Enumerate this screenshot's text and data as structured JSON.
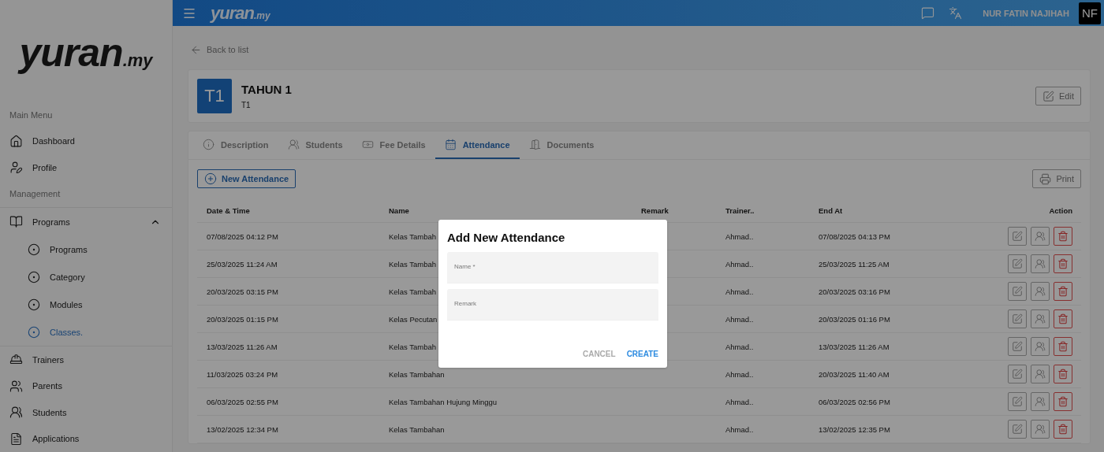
{
  "logo": {
    "name": "yuran",
    "suffix": ".my"
  },
  "sidebar": {
    "sections": [
      {
        "header": "Main Menu",
        "items": [
          {
            "label": "Dashboard",
            "selected": false
          },
          {
            "label": "Profile",
            "selected": false
          }
        ]
      },
      {
        "header": "Management",
        "items": [
          {
            "label": "Programs",
            "selected": false,
            "expanded": true,
            "children": [
              {
                "label": "Programs",
                "selected": false
              },
              {
                "label": "Category",
                "selected": false
              },
              {
                "label": "Modules",
                "selected": false
              },
              {
                "label": "Classes.",
                "selected": true
              }
            ]
          },
          {
            "label": "Trainers",
            "selected": false
          },
          {
            "label": "Parents",
            "selected": false
          },
          {
            "label": "Students",
            "selected": false
          },
          {
            "label": "Applications",
            "selected": false
          }
        ]
      }
    ]
  },
  "topbar": {
    "logo": {
      "name": "yuran",
      "suffix": ".my"
    },
    "user": "NUR FATIN NAJIHAH",
    "avatar": "NF"
  },
  "back_link": "Back to list",
  "header": {
    "badge": "T1",
    "title": "TAHUN 1",
    "subtitle": "T1",
    "edit_button": "Edit"
  },
  "tabs": [
    {
      "label": "Description",
      "selected": false
    },
    {
      "label": "Students",
      "selected": false
    },
    {
      "label": "Fee Details",
      "selected": false
    },
    {
      "label": "Attendance",
      "selected": true
    },
    {
      "label": "Documents",
      "selected": false
    }
  ],
  "toolbar": {
    "new_button": "New Attendance",
    "print_button": "Print"
  },
  "table": {
    "columns": [
      "Date & Time",
      "Name",
      "Remark",
      "Trainer..",
      "End At",
      "Action"
    ],
    "rows": [
      {
        "date": "07/08/2025 04:12 PM",
        "name": "Kelas Tambah",
        "trainer": "Ahmad..",
        "end": "07/08/2025 04:13 PM"
      },
      {
        "date": "25/03/2025 11:24 AM",
        "name": "Kelas Tambah",
        "trainer": "Ahmad..",
        "end": "25/03/2025 11:25 AM"
      },
      {
        "date": "20/03/2025 03:15 PM",
        "name": "Kelas Tambah",
        "trainer": "Ahmad..",
        "end": "20/03/2025 03:16 PM"
      },
      {
        "date": "20/03/2025 01:15 PM",
        "name": "Kelas Pecutan",
        "trainer": "Ahmad..",
        "end": "20/03/2025 01:16 PM"
      },
      {
        "date": "13/03/2025 11:26 AM",
        "name": "Kelas Tambah",
        "trainer": "Ahmad..",
        "end": "13/03/2025 11:26 AM"
      },
      {
        "date": "11/03/2025 03:24 PM",
        "name": "Kelas Tambahan",
        "trainer": "Ahmad..",
        "end": "20/03/2025 11:40 AM"
      },
      {
        "date": "06/03/2025 02:55 PM",
        "name": "Kelas Tambahan Hujung Minggu",
        "trainer": "Ahmad..",
        "end": "06/03/2025 02:56 PM"
      },
      {
        "date": "13/02/2025 12:34 PM",
        "name": "Kelas Tambahan",
        "trainer": "Ahmad..",
        "end": "13/02/2025 12:35 PM"
      }
    ]
  },
  "dialog": {
    "title": "Add New Attendance",
    "fields": [
      {
        "label": "Name *"
      },
      {
        "label": "Remark"
      }
    ],
    "buttons": [
      {
        "label": "CANCEL",
        "kind": "secondary"
      },
      {
        "label": "CREATE",
        "kind": "primary"
      }
    ]
  }
}
